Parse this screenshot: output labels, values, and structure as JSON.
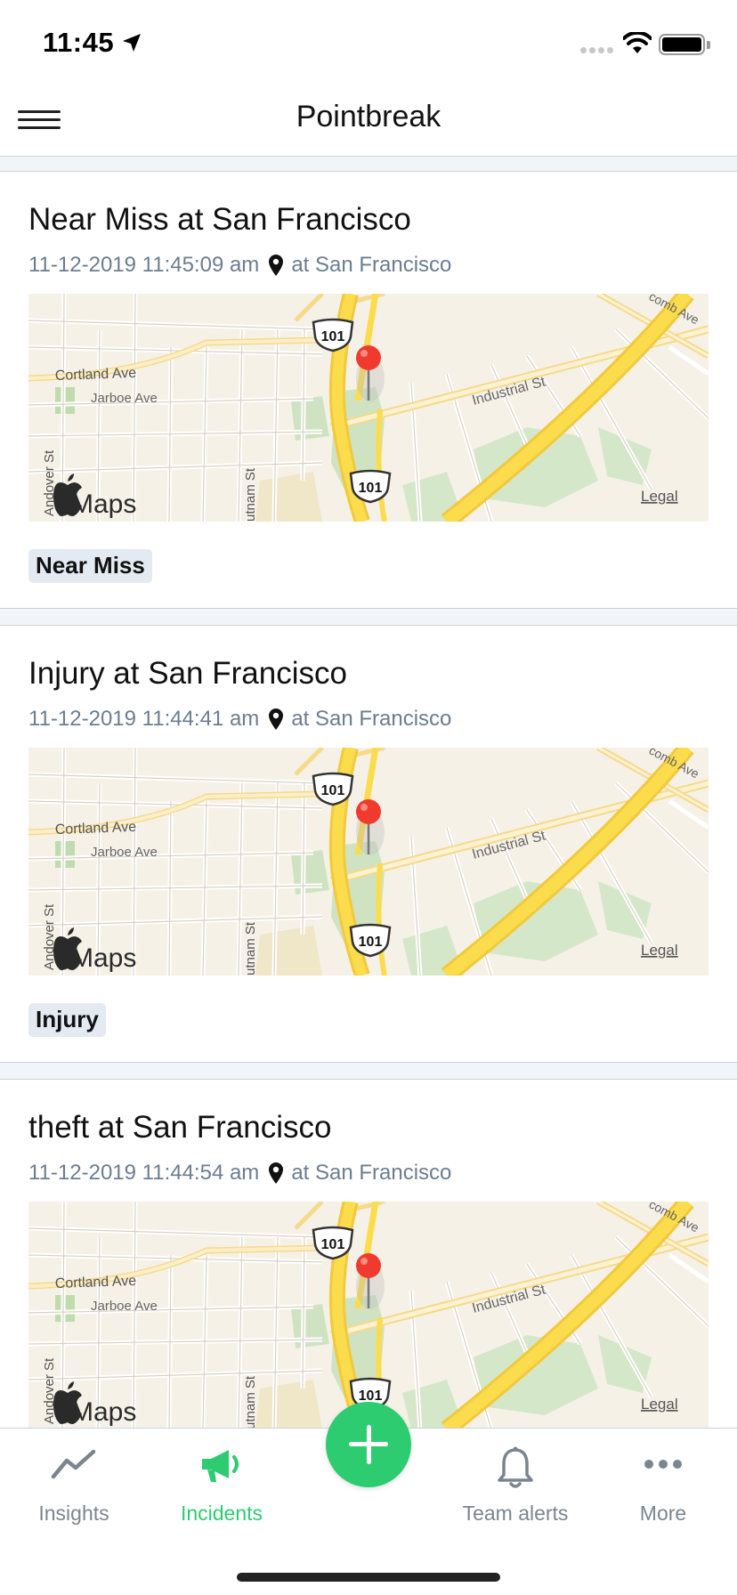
{
  "status_bar": {
    "time": "11:45"
  },
  "nav": {
    "title": "Pointbreak"
  },
  "map_labels": {
    "street_1": "Cortland Ave",
    "street_2": "Jarboe Ave",
    "street_3": "Industrial St",
    "street_4": "Andover St",
    "street_5": "utnam St",
    "street_6": "comb Ave",
    "highway": "101",
    "brand": "Maps",
    "legal": "Legal"
  },
  "incidents": [
    {
      "title": "Near Miss at San Francisco",
      "timestamp": "11-12-2019 11:45:09 am",
      "location": "at San Francisco",
      "tag": "Near Miss"
    },
    {
      "title": "Injury at San Francisco",
      "timestamp": "11-12-2019 11:44:41 am",
      "location": "at San Francisco",
      "tag": "Injury"
    },
    {
      "title": "theft at San Francisco",
      "timestamp": "11-12-2019 11:44:54 am",
      "location": "at San Francisco",
      "tag": ""
    }
  ],
  "tabs": [
    {
      "label": "Insights",
      "icon": "chart-line-icon"
    },
    {
      "label": "Incidents",
      "icon": "megaphone-icon"
    },
    {
      "label": "",
      "icon": "plus-icon"
    },
    {
      "label": "Team alerts",
      "icon": "bell-icon"
    },
    {
      "label": "More",
      "icon": "more-dots-icon"
    }
  ],
  "colors": {
    "accent": "#2ecc71",
    "meta_text": "#6b7d90",
    "pin": "#f03a2e"
  }
}
